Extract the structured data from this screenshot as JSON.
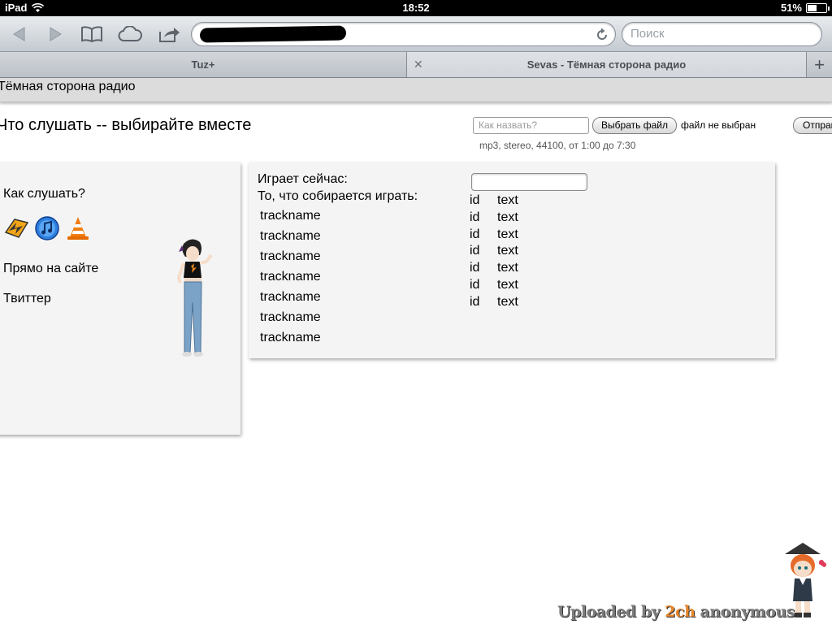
{
  "status_bar": {
    "device": "iPad",
    "time": "18:52",
    "battery_text": "51%",
    "battery_level": 0.51
  },
  "browser": {
    "search_placeholder": "Поиск",
    "tabs": [
      {
        "label": "Tuz+"
      },
      {
        "label": "Sevas - Тёмная сторона радио"
      }
    ]
  },
  "site": {
    "header_title": "Тёмная сторона радио",
    "heading": "Что слушать -- выбирайте вместе",
    "upload": {
      "name_placeholder": "Как назвать?",
      "choose_file_label": "Выбрать файл",
      "no_file_text": "файл не выбран",
      "send_label": "Отправить",
      "hint": "mp3, stereo, 44100, от 1:00 до 7:30"
    },
    "left_panel": {
      "how_to_listen": "Как слушать?",
      "on_site": "Прямо на сайте",
      "twitter": "Твиттер",
      "player_icons": [
        "winamp-icon",
        "itunes-icon",
        "vlc-icon"
      ]
    },
    "main_panel": {
      "now_playing_label": "Играет сейчас:",
      "upcoming_label": "То, что собирается играть:",
      "tracks": [
        "trackname",
        "trackname",
        "trackname",
        "trackname",
        "trackname",
        "trackname",
        "trackname"
      ],
      "rows": [
        {
          "id": "id",
          "text": "text"
        },
        {
          "id": "id",
          "text": "text"
        },
        {
          "id": "id",
          "text": "text"
        },
        {
          "id": "id",
          "text": "text"
        },
        {
          "id": "id",
          "text": "text"
        },
        {
          "id": "id",
          "text": "text"
        },
        {
          "id": "id",
          "text": "text"
        }
      ]
    }
  },
  "watermark": {
    "prefix": "Uploaded by ",
    "highlight": "2ch",
    "suffix": " anonymous"
  },
  "colors": {
    "watermark_accent": "#e8872e",
    "panel_bg": "#f4f4f4"
  }
}
